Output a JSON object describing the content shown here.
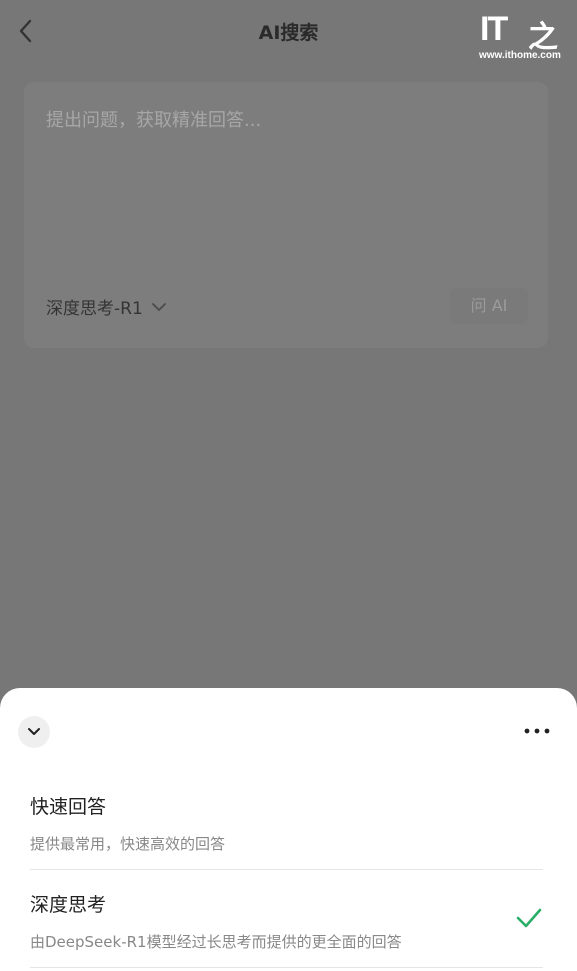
{
  "header": {
    "title": "AI搜索",
    "back_icon": "chevron-left-icon"
  },
  "watermark": {
    "logo_text": "IT",
    "logo_char": "之",
    "url": "www.ithome.com"
  },
  "search_card": {
    "placeholder": "提出问题，获取精准回答...",
    "selected_mode": "深度思考-R1",
    "ask_button": "问 AI"
  },
  "mode_sheet": {
    "options": [
      {
        "title": "快速回答",
        "description": "提供最常用，快速高效的回答",
        "selected": false
      },
      {
        "title": "深度思考",
        "description": "由DeepSeek-R1模型经过长思考而提供的更全面的回答",
        "selected": true
      }
    ]
  },
  "colors": {
    "overlay": "#777777",
    "check_green": "#2aae67",
    "sheet_bg": "#ffffff"
  }
}
